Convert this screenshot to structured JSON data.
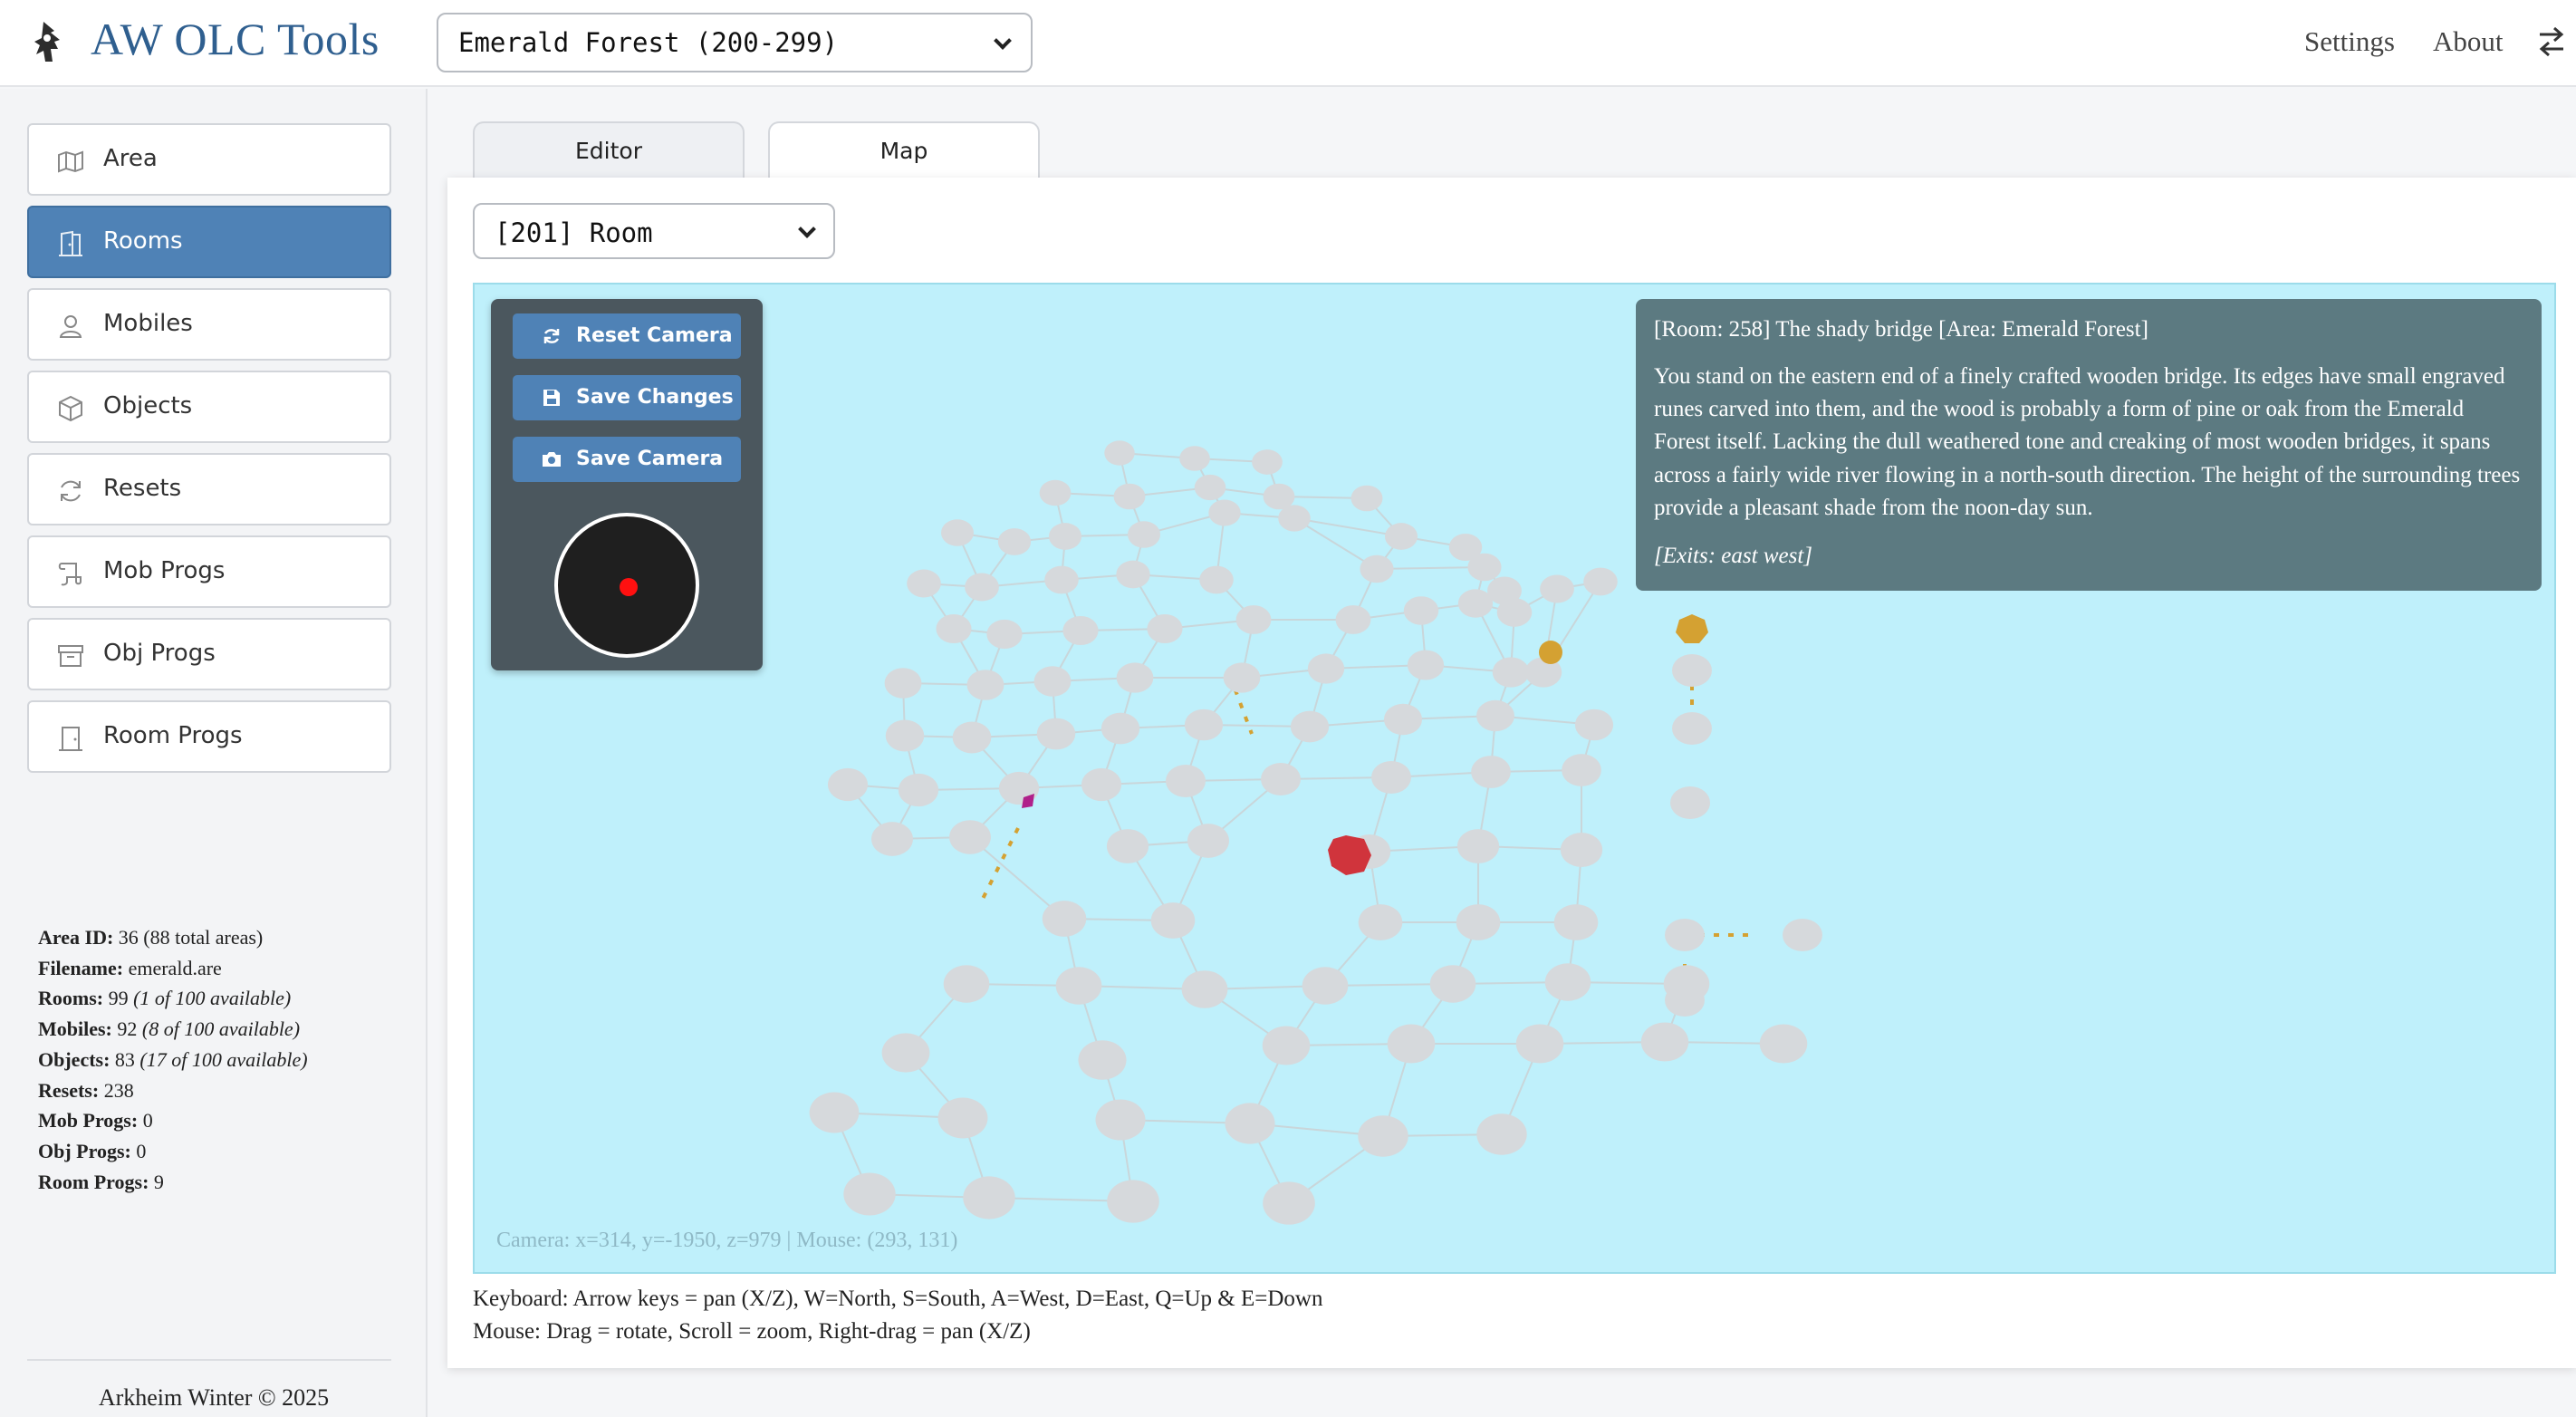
{
  "header": {
    "title": "AW OLC Tools",
    "area_select_value": "Emerald Forest (200-299)",
    "nav": [
      {
        "label": "Settings"
      },
      {
        "label": "About"
      }
    ]
  },
  "sidebar": {
    "items": [
      {
        "label": "Area",
        "icon": "map-icon",
        "active": false
      },
      {
        "label": "Rooms",
        "icon": "door-icon",
        "active": true
      },
      {
        "label": "Mobiles",
        "icon": "person-icon",
        "active": false
      },
      {
        "label": "Objects",
        "icon": "box-icon",
        "active": false
      },
      {
        "label": "Resets",
        "icon": "refresh-icon",
        "active": false
      },
      {
        "label": "Mob Progs",
        "icon": "scroll-icon",
        "active": false
      },
      {
        "label": "Obj Progs",
        "icon": "archive-icon",
        "active": false
      },
      {
        "label": "Room Progs",
        "icon": "door-closed-icon",
        "active": false
      }
    ],
    "stats": {
      "area_id_label": "Area ID:",
      "area_id": "36 (88 total areas)",
      "filename_label": "Filename:",
      "filename": "emerald.are",
      "rooms_label": "Rooms:",
      "rooms": "99",
      "rooms_avail": "(1 of 100 available)",
      "mobiles_label": "Mobiles:",
      "mobiles": "92",
      "mobiles_avail": "(8 of 100 available)",
      "objects_label": "Objects:",
      "objects": "83",
      "objects_avail": "(17 of 100 available)",
      "resets_label": "Resets:",
      "resets": "238",
      "mobprogs_label": "Mob Progs:",
      "mobprogs": "0",
      "objprogs_label": "Obj Progs:",
      "objprogs": "0",
      "roomprogs_label": "Room Progs:",
      "roomprogs": "9"
    },
    "footer": "Arkheim Winter © 2025"
  },
  "tabs": [
    {
      "label": "Editor",
      "active": false
    },
    {
      "label": "Map",
      "active": true
    }
  ],
  "map": {
    "room_select_value": "[201] Room",
    "controls": {
      "reset_camera": "Reset Camera",
      "save_changes": "Save Changes",
      "save_camera": "Save Camera"
    },
    "info": {
      "title": "[Room: 258] The shady bridge [Area: Emerald Forest]",
      "description": "You stand on the eastern end of a finely crafted wooden bridge. Its edges have small engraved runes carved into them, and the wood is probably a form of pine or oak from the Emerald Forest itself. Lacking the dull weathered tone and creaking of most wooden bridges, it spans across a fairly wide river flowing in a north-south direction. The height of the surrounding trees provide a pleasant shade from the noon-day sun.",
      "exits": "[Exits: east west]"
    },
    "camera_readout": "Camera: x=314, y=-1950, z=979 | Mouse: (293, 131)",
    "colors": {
      "viewport_bg": "#bff0fb",
      "room_node": "#d6d9dc",
      "selected_room": "#d0343c",
      "exit_room": "#d4a132",
      "special_room": "#b0208a",
      "accent": "#4f82b6"
    }
  },
  "help": {
    "keyboard": "Keyboard: Arrow keys = pan (X/Z), W=North, S=South, A=West, D=East, Q=Up & E=Down",
    "mouse": "Mouse: Drag = rotate, Scroll = zoom, Right-drag = pan (X/Z)"
  }
}
